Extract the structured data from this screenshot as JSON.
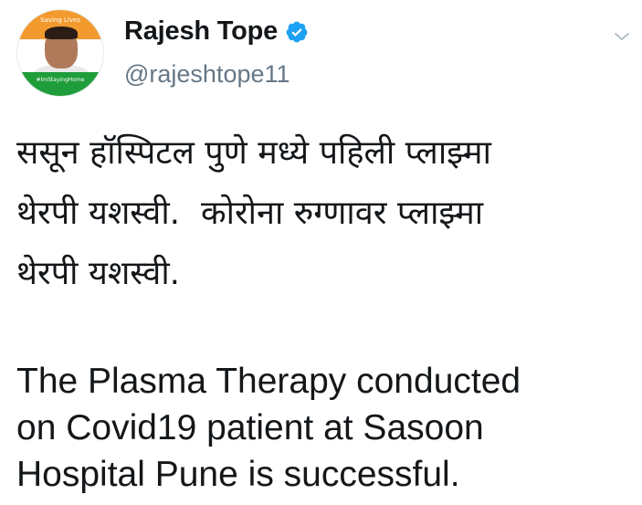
{
  "tweet": {
    "author": {
      "display_name": "Rajesh Tope",
      "handle": "@rajeshtope11",
      "verified": true,
      "avatar": {
        "top_text": "Saving Lives",
        "bottom_text": "#ImStayingHome"
      }
    },
    "body_marathi": "ससून हॉस्पिटल पुणे मध्ये पहिली प्लाझ्मा\nथेरपी यशस्वी.  कोरोना रुग्णावर प्लाझ्मा\nथेरपी यशस्वी.",
    "body_english": "The Plasma Therapy conducted\non Covid19 patient at Sasoon\nHospital Pune is successful."
  },
  "icons": {
    "verified": "verified-badge-icon",
    "menu": "chevron-down-icon"
  },
  "colors": {
    "verified_blue": "#1da1f2",
    "handle_gray": "#657786",
    "text": "#14171a"
  }
}
